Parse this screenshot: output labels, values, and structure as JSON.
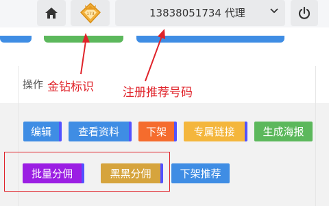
{
  "topbar": {
    "home_icon": "home-icon",
    "badge_icon": "gold-diamond-badge-icon",
    "badge_text": "173",
    "account_text": "13838051734 代理",
    "power_icon": "power-icon",
    "chevron_icon": "chevron-down-icon"
  },
  "table": {
    "header_operation": "操作"
  },
  "action_buttons": {
    "edit": "编辑",
    "view_info": "查看资料",
    "remove": "下架",
    "exclusive_link": "专属链接",
    "generate_poster": "生成海报",
    "batch_commission": "批量分佣",
    "blacklist_commission": "黑黑分佣",
    "remove_recommend": "下架推荐"
  },
  "annotations": {
    "gold_diamond_mark": "金钻标识",
    "registered_number": "注册推荐号码"
  },
  "colors": {
    "annotation_red": "#e0232a",
    "blue": "#3f8de4",
    "orange": "#f56c2d",
    "yellow": "#f4b63c",
    "green": "#5cb85c",
    "purple": "#9b1ee3",
    "gold": "#d6a43d",
    "border_blue": "#5252ff"
  }
}
